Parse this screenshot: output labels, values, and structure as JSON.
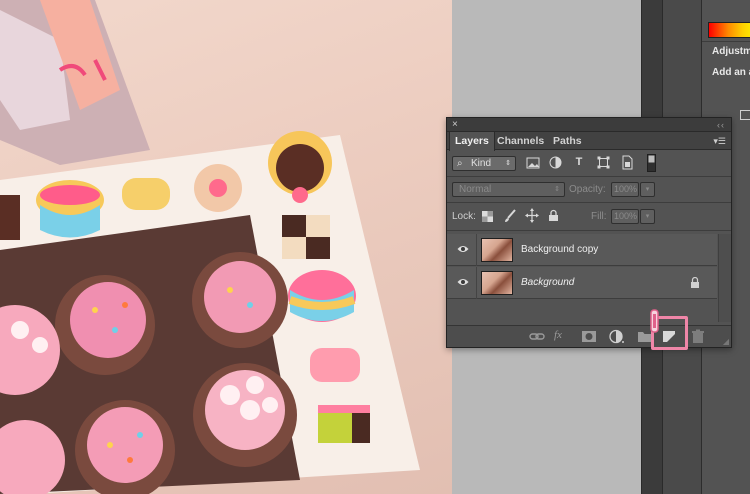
{
  "layers_panel": {
    "close_glyph": "×",
    "grip_glyph": "‹‹",
    "tabs": [
      {
        "label": "Layers",
        "active": true
      },
      {
        "label": "Channels",
        "active": false
      },
      {
        "label": "Paths",
        "active": false
      }
    ],
    "menu_glyph": "▾☰",
    "filter": {
      "label": "Kind",
      "search_glyph": "⌕"
    },
    "blend_mode": "Normal",
    "opacity": {
      "label": "Opacity:",
      "value": "100%"
    },
    "lock_label": "Lock:",
    "fill": {
      "label": "Fill:",
      "value": "100%"
    },
    "layers": [
      {
        "name": "Background copy",
        "italic": false,
        "locked": false
      },
      {
        "name": "Background",
        "italic": true,
        "locked": true
      }
    ]
  },
  "dock": {
    "adjustments_label": "Adjustm",
    "add_label": "Add an a"
  },
  "colors": {
    "panel_bg": "#535353",
    "highlight": "#ef86a8"
  }
}
